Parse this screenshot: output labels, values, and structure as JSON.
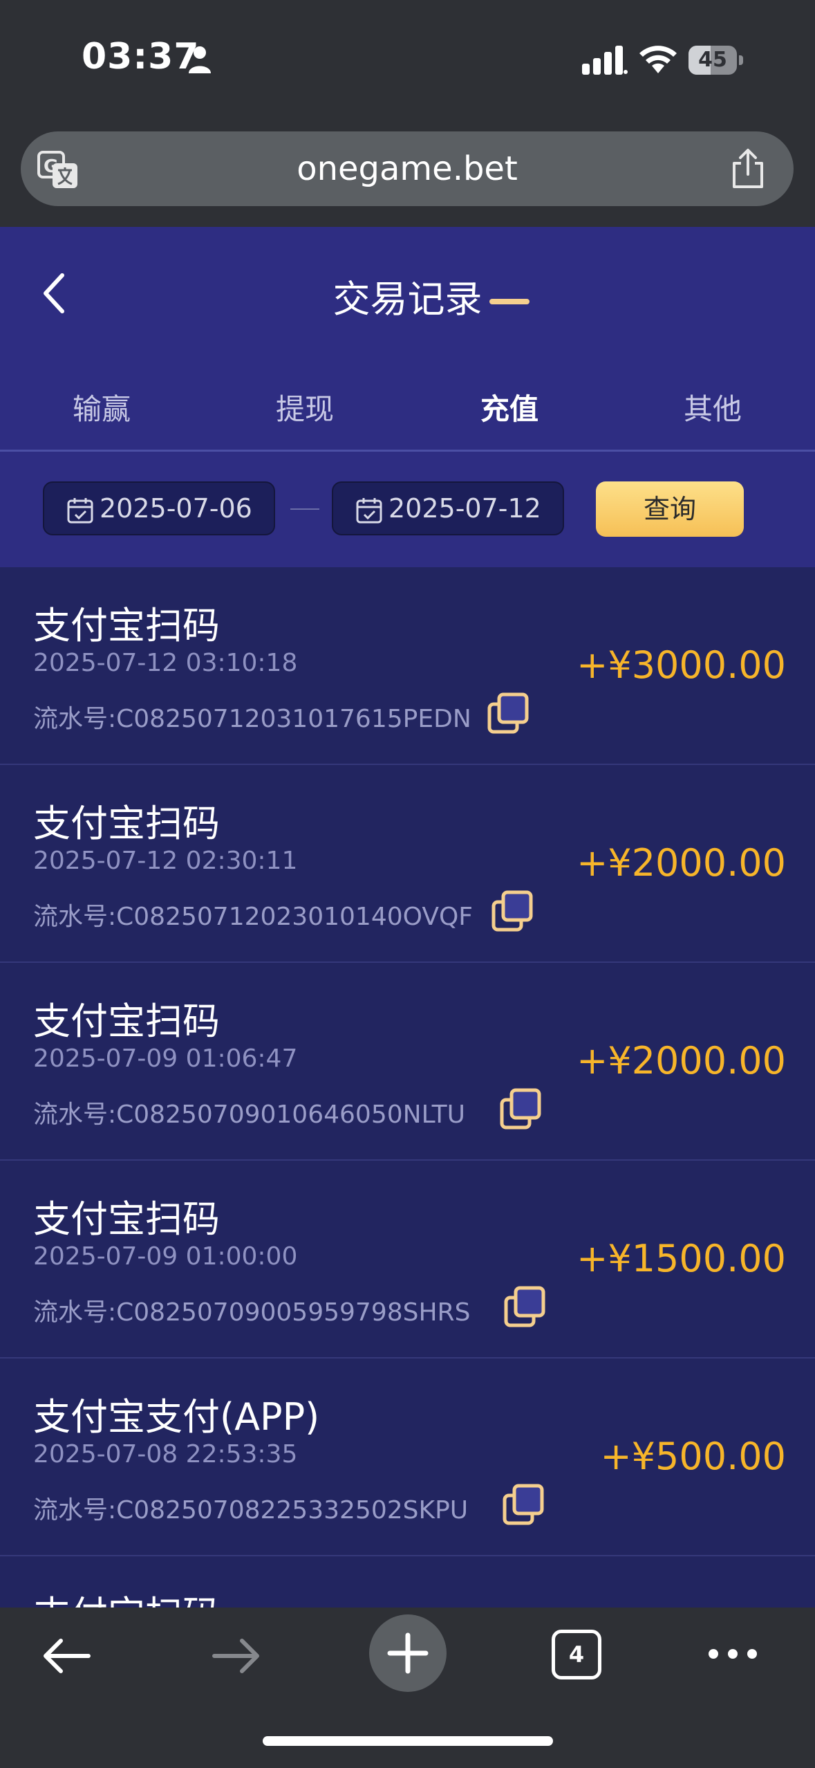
{
  "status_bar": {
    "time": "03:37",
    "battery": "45"
  },
  "browser": {
    "url": "onegame.bet",
    "tab_count": "4"
  },
  "header": {
    "title": "交易记录"
  },
  "tabs": [
    {
      "label": "输赢"
    },
    {
      "label": "提现"
    },
    {
      "label": "充值",
      "active": true
    },
    {
      "label": "其他"
    }
  ],
  "filter": {
    "start_date": "2025-07-06",
    "end_date": "2025-07-12",
    "query_label": "查询"
  },
  "records": [
    {
      "title": "支付宝扫码",
      "time": "2025-07-12 03:10:18",
      "serial": "流水号:C08250712031017615PEDN",
      "amount": "+¥3000.00"
    },
    {
      "title": "支付宝扫码",
      "time": "2025-07-12 02:30:11",
      "serial": "流水号:C08250712023010140OVQF",
      "amount": "+¥2000.00"
    },
    {
      "title": "支付宝扫码",
      "time": "2025-07-09 01:06:47",
      "serial": "流水号:C08250709010646050NLTU",
      "amount": "+¥2000.00"
    },
    {
      "title": "支付宝扫码",
      "time": "2025-07-09 01:00:00",
      "serial": "流水号:C08250709005959798SHRS",
      "amount": "+¥1500.00"
    },
    {
      "title": "支付宝支付(APP)",
      "time": "2025-07-08 22:53:35",
      "serial": "流水号:C08250708225332502SKPU",
      "amount": "+¥500.00"
    },
    {
      "title": "支付宝扫码",
      "time": "",
      "serial": "",
      "amount": ""
    }
  ],
  "colors": {
    "header": "#2e2d82",
    "list_bg": "#222560",
    "amount": "#f7b52a",
    "accent": "#f5cf8e"
  }
}
